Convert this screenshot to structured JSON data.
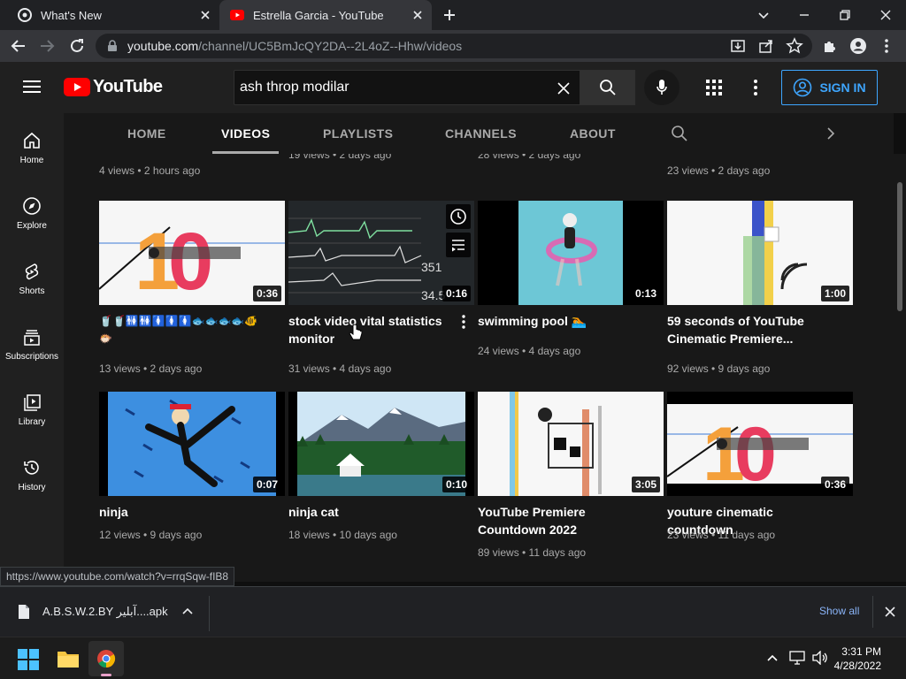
{
  "browser": {
    "tabs": [
      {
        "title": "What's New"
      },
      {
        "title": "Estrella Garcia - YouTube"
      }
    ],
    "url_host": "youtube.com",
    "url_path": "/channel/UC5BmJcQY2DA--2L4oZ--Hhw/videos",
    "status_url": "https://www.youtube.com/watch?v=rrqSqw-fIB8"
  },
  "youtube": {
    "logo_text": "YouTube",
    "search_value": "ash throp modilar",
    "signin_label": "SIGN IN",
    "channel_tabs": [
      "HOME",
      "VIDEOS",
      "PLAYLISTS",
      "CHANNELS",
      "ABOUT"
    ],
    "sidenav": [
      {
        "label": "Home"
      },
      {
        "label": "Explore"
      },
      {
        "label": "Shorts"
      },
      {
        "label": "Subscriptions"
      },
      {
        "label": "Library"
      },
      {
        "label": "History"
      }
    ],
    "prev_row_meta": [
      "4 views • 2 hours ago",
      "19 views • 2 days ago",
      "28 views • 2 days ago",
      "23 views • 2 days ago"
    ],
    "videos": [
      {
        "title": "🥤🥤🚻🚻🚺🚺🚺🐟🐟🐟🐟🐠🐡",
        "meta": "13 views • 2 days ago",
        "duration": "0:36"
      },
      {
        "title": "stock video vital statistics monitor",
        "meta": "31 views • 4 days ago",
        "duration": "0:16"
      },
      {
        "title": "swimming pool 🏊",
        "meta": "24 views • 4 days ago",
        "duration": "0:13"
      },
      {
        "title": "59 seconds of YouTube Cinematic Premiere...",
        "meta": "92 views • 9 days ago",
        "duration": "1:00"
      },
      {
        "title": "ninja",
        "meta": "12 views • 9 days ago",
        "duration": "0:07"
      },
      {
        "title": "ninja cat",
        "meta": "18 views • 10 days ago",
        "duration": "0:10"
      },
      {
        "title": "YouTube Premiere Countdown 2022",
        "meta": "89 views • 11 days ago",
        "duration": "3:05"
      },
      {
        "title": "youture cinematic countdown",
        "meta": "23 views • 11 days ago",
        "duration": "0:36"
      }
    ]
  },
  "download": {
    "filename": "A.B.S.W.2.BY آبلیر....apk",
    "show_all": "Show all"
  },
  "taskbar": {
    "time": "3:31 PM",
    "date": "4/28/2022"
  },
  "colors": {
    "youtube_red": "#ff0000",
    "link_blue": "#3ea6ff",
    "background": "#181818"
  }
}
